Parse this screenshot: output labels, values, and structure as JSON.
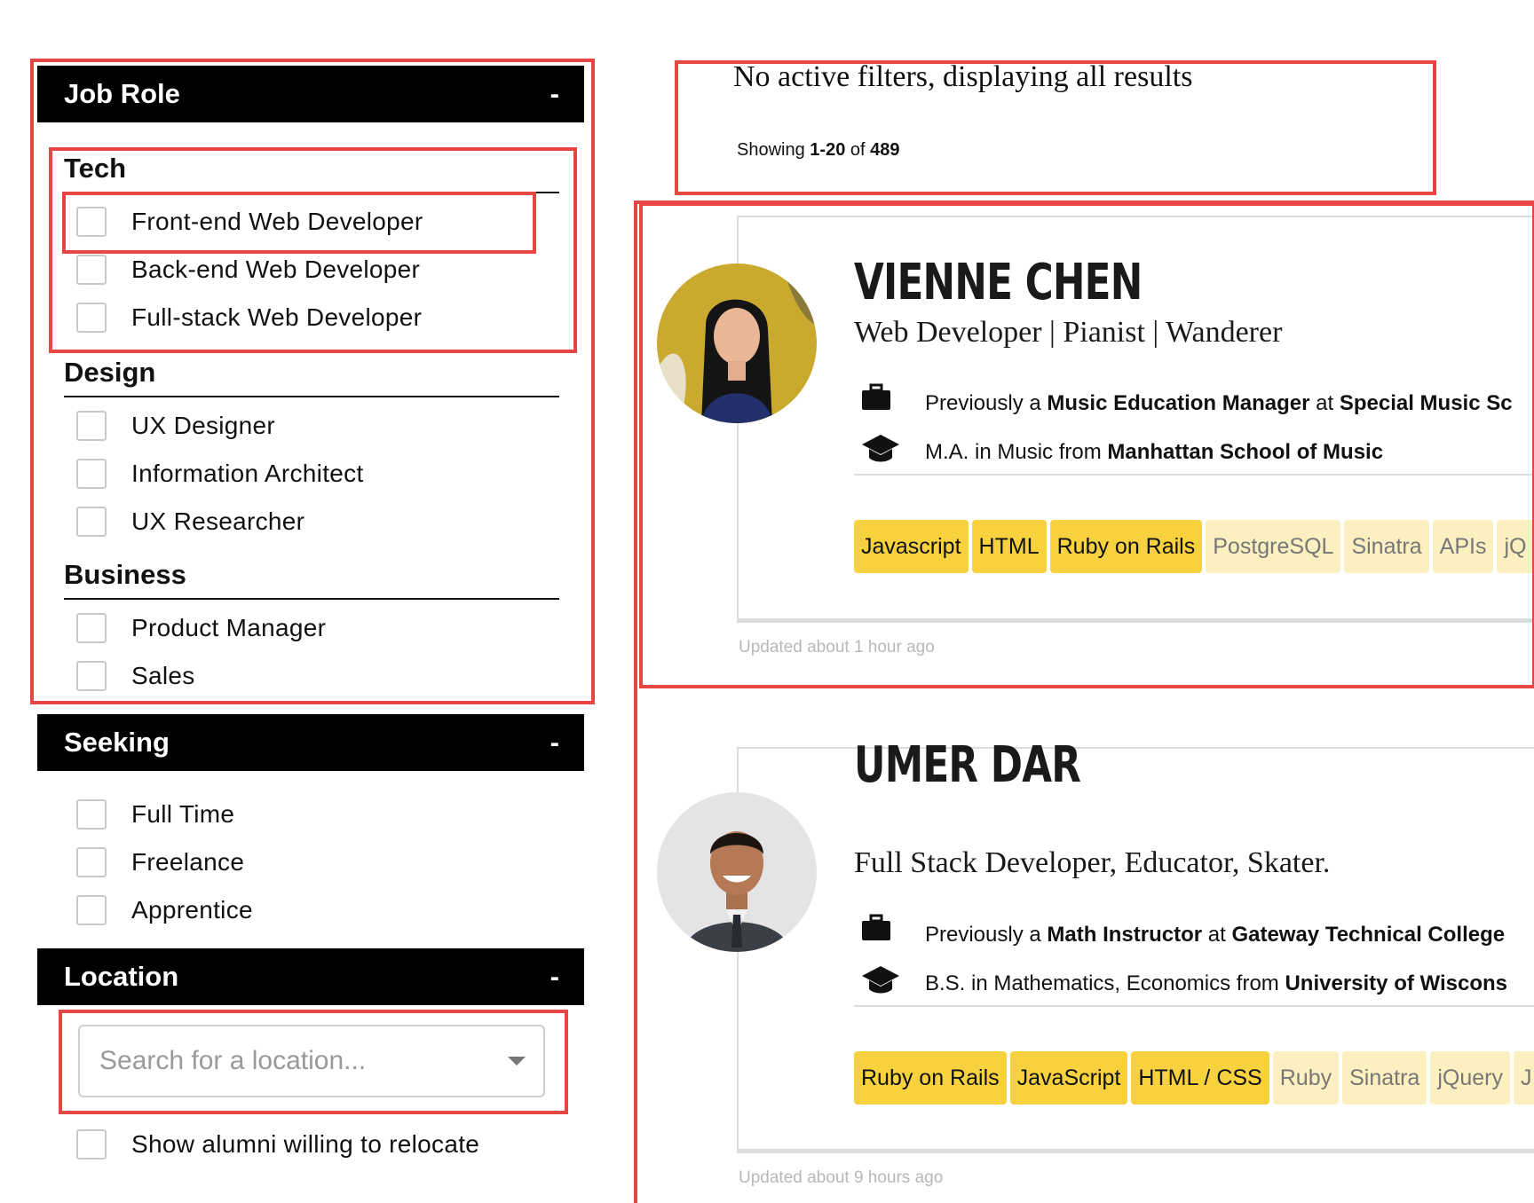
{
  "filters": {
    "job_role": {
      "title": "Job Role",
      "toggle": "-",
      "groups": [
        {
          "title": "Tech",
          "options": [
            "Front-end Web Developer",
            "Back-end Web Developer",
            "Full-stack Web Developer"
          ]
        },
        {
          "title": "Design",
          "options": [
            "UX Designer",
            "Information Architect",
            "UX Researcher"
          ]
        },
        {
          "title": "Business",
          "options": [
            "Product Manager",
            "Sales"
          ]
        }
      ]
    },
    "seeking": {
      "title": "Seeking",
      "toggle": "-",
      "options": [
        "Full Time",
        "Freelance",
        "Apprentice"
      ]
    },
    "location": {
      "title": "Location",
      "toggle": "-",
      "placeholder": "Search for a location...",
      "relocate_label": "Show alumni willing to relocate"
    }
  },
  "results": {
    "status": "No active filters, displaying all results",
    "showing_label": "Showing",
    "range": "1-20",
    "of_label": "of",
    "total": "489"
  },
  "profiles": [
    {
      "name": "VIENNE CHEN",
      "tagline": "Web Developer | Pianist | Wanderer",
      "previously_label": "Previously a",
      "role": "Music Education Manager",
      "at_label": "at",
      "company": "Special Music Sc",
      "degree": "M.A. in Music from",
      "school": "Manhattan School of Music",
      "skills_primary": [
        "Javascript",
        "HTML",
        "Ruby on Rails"
      ],
      "skills_secondary": [
        "PostgreSQL",
        "Sinatra",
        "APIs",
        "jQ"
      ],
      "updated": "Updated about 1 hour ago"
    },
    {
      "name": "UMER DAR",
      "tagline": "Full Stack Developer, Educator, Skater.",
      "previously_label": "Previously a",
      "role": "Math Instructor",
      "at_label": "at",
      "company": "Gateway Technical College",
      "degree": "B.S. in Mathematics, Economics from",
      "school": "University of Wiscons",
      "skills_primary": [
        "Ruby on Rails",
        "JavaScript",
        "HTML / CSS"
      ],
      "skills_secondary": [
        "Ruby",
        "Sinatra",
        "jQuery",
        "J"
      ],
      "updated": "Updated about 9 hours ago"
    }
  ],
  "colors": {
    "annotation": "#e84545",
    "tag_primary": "#f7d23e",
    "tag_secondary": "#fcefc0",
    "header_bg": "#000000"
  },
  "icons": [
    "briefcase-icon",
    "graduation-cap-icon",
    "chevron-down-icon"
  ]
}
